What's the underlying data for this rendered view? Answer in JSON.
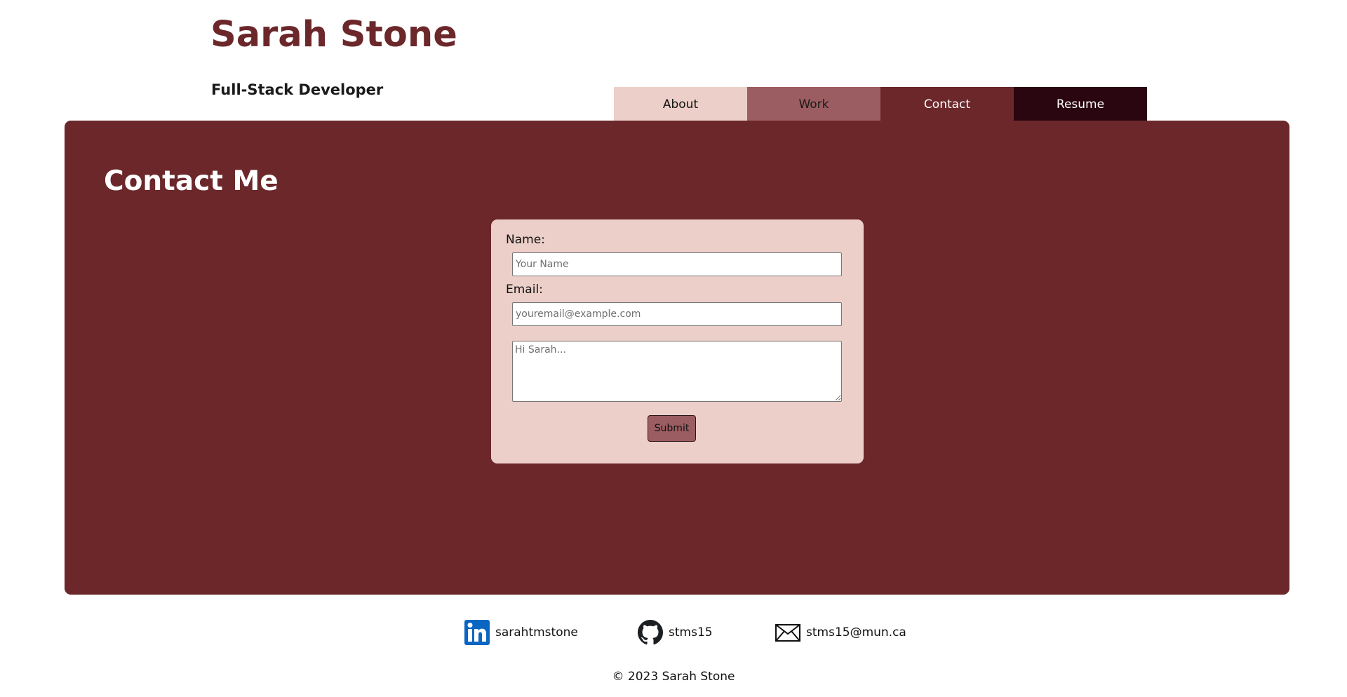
{
  "header": {
    "title": "Sarah Stone",
    "subtitle": "Full-Stack Developer"
  },
  "nav": {
    "tabs": [
      {
        "label": "About"
      },
      {
        "label": "Work"
      },
      {
        "label": "Contact"
      },
      {
        "label": "Resume"
      }
    ],
    "active": "Contact"
  },
  "main": {
    "heading": "Contact Me",
    "form": {
      "name_label": "Name:",
      "name_placeholder": "Your Name",
      "name_value": "",
      "email_label": "Email:",
      "email_placeholder": "youremail@example.com",
      "email_value": "",
      "message_placeholder": "Hi Sarah...",
      "message_value": "",
      "submit_label": "Submit"
    }
  },
  "footer": {
    "links": [
      {
        "icon": "linkedin-icon",
        "label": "sarahtmstone"
      },
      {
        "icon": "github-icon",
        "label": "stms15"
      },
      {
        "icon": "envelope-icon",
        "label": "stms15@mun.ca"
      }
    ],
    "copyright": "© 2023 Sarah Stone"
  },
  "colors": {
    "brand": "#6b272a",
    "form_background": "#ebcfc8",
    "tab_about": "#ebcfc8",
    "tab_work": "#9b5d61",
    "tab_contact": "#6b272a",
    "tab_resume": "#2a0611",
    "linkedin": "#0a66c2"
  }
}
